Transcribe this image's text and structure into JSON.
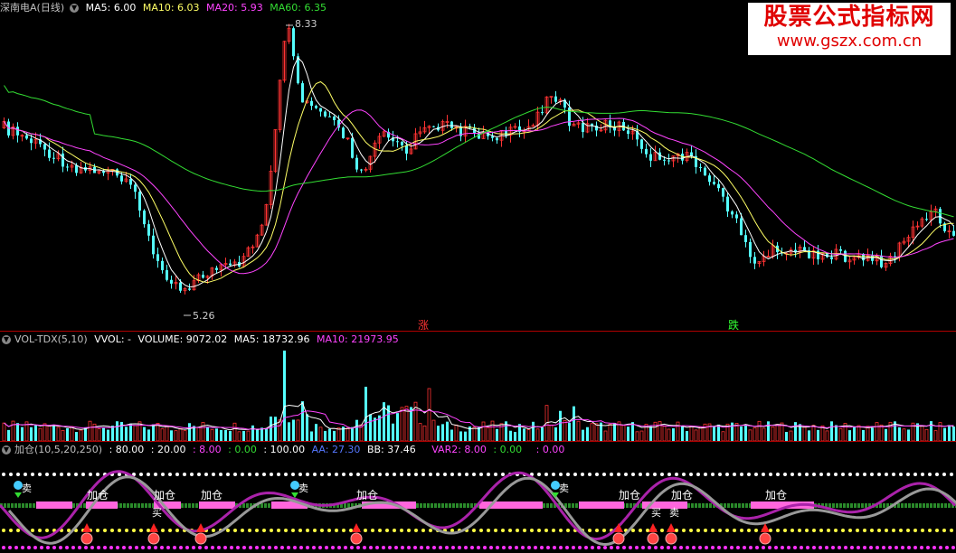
{
  "price_panel": {
    "title": "深南电A(日线)",
    "ma5": "MA5: 6.00",
    "ma10": "MA10: 6.03",
    "ma20": "MA20: 5.93",
    "ma60": "MA60: 6.35",
    "high_label": "8.33",
    "low_label": "5.26",
    "rise_marker": "涨",
    "fall_marker": "跌"
  },
  "volume_panel": {
    "title": "VOL-TDX(5,10)",
    "vvol": "VVOL: -",
    "volume": "VOLUME: 9072.02",
    "ma5": "MA5: 18732.96",
    "ma10": "MA10: 21973.95"
  },
  "indicator_panel": {
    "title": "加仓(10,5,20,250)",
    "v1": ": 80.00",
    "v2": ": 20.00",
    "v3": ": 8.00",
    "v4": ": 0.00",
    "v5": ": 100.00",
    "aa": "AA: 27.30",
    "bb": "BB: 37.46",
    "var2": "VAR2: 8.00",
    "v6": ": 0.00",
    "v7": ": 0.00",
    "add_label": "加仓",
    "buy_label": "买",
    "sell_label": "卖"
  },
  "watermark": {
    "title": "股票公式指标网",
    "url": "www.gszx.com.cn"
  },
  "colors": {
    "up": "#ff3333",
    "down": "#54ffff",
    "ma5": "#ffffff",
    "ma10": "#ffff66",
    "ma20": "#ff44ff",
    "ma60": "#33dd33",
    "divider": "#b00000",
    "watermark": "#e00000"
  }
}
